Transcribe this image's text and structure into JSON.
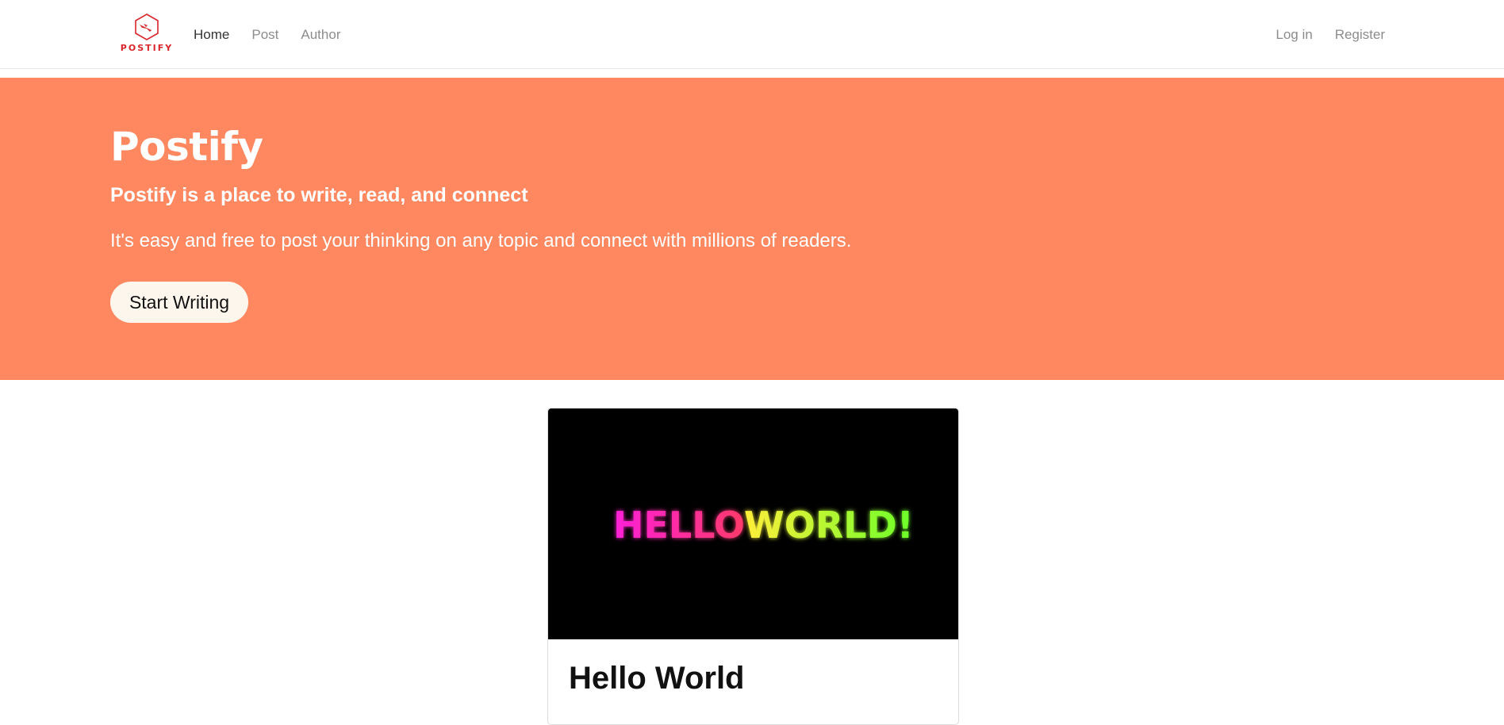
{
  "brand": {
    "name": "POSTIFY",
    "color": "#d9252a"
  },
  "nav": {
    "left_items": [
      {
        "label": "Home",
        "active": true
      },
      {
        "label": "Post",
        "active": false
      },
      {
        "label": "Author",
        "active": false
      }
    ],
    "right_items": [
      {
        "label": "Log in"
      },
      {
        "label": "Register"
      }
    ]
  },
  "hero": {
    "title": "Postify",
    "subtitle": "Postify is a place to write, read, and connect",
    "description": "It's easy and free to post your thinking on any topic and connect with millions of readers.",
    "button_label": "Start Writing",
    "background_color": "#ff8860"
  },
  "posts": [
    {
      "title": "Hello World",
      "image": {
        "text_part1": "HELLO",
        "text_part2": "WORLD!",
        "background": "#000000"
      }
    }
  ]
}
